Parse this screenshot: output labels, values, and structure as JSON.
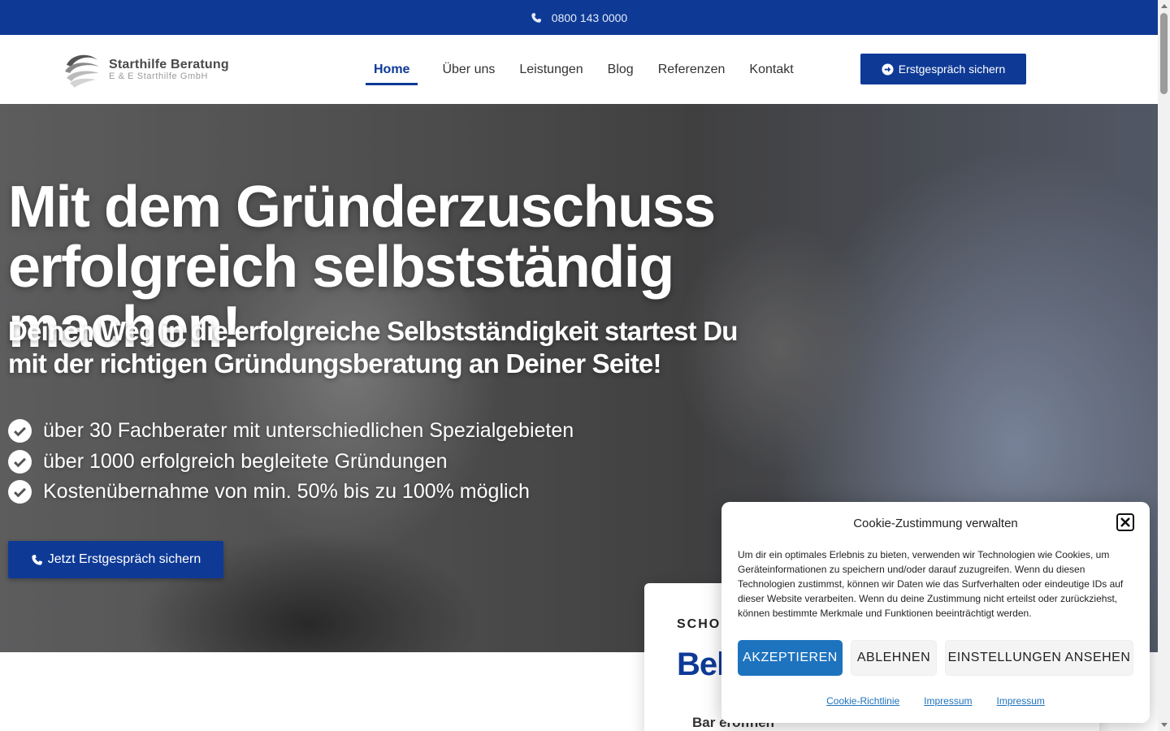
{
  "topbar": {
    "phone": "0800 143 0000",
    "icon": "phone-icon"
  },
  "brand": {
    "name": "Starthilfe Beratung",
    "company": "E & E Starthilfe GmbH"
  },
  "nav": {
    "items": [
      {
        "label": "Home",
        "active": true
      },
      {
        "label": "Über uns"
      },
      {
        "label": "Leistungen"
      },
      {
        "label": "Blog"
      },
      {
        "label": "Referenzen"
      },
      {
        "label": "Kontakt"
      }
    ],
    "cta": "Erstgespräch sichern"
  },
  "hero": {
    "headline": "Mit dem Gründerzuschuss erfolgreich selbstständig machen!",
    "subheadline": "Deinen Weg in die erfolgreiche Selbstständigkeit startest Du mit der richtigen Gründungsberatung an Deiner Seite!",
    "bullets": [
      "über 30 Fachberater mit unterschiedlichen Spezialgebieten",
      "über 1000 erfolgreich begleitete Gründungen",
      "Kostenübernahme von min. 50% bis zu 100% möglich"
    ],
    "cta": "Jetzt Erstgespräch sichern"
  },
  "card": {
    "eyebrow": "SCHON",
    "title": "Beli",
    "item": "Bar eröffnen"
  },
  "cookie": {
    "title": "Cookie-Zustimmung verwalten",
    "body": "Um dir ein optimales Erlebnis zu bieten, verwenden wir Technologien wie Cookies, um Geräteinformationen zu speichern und/oder darauf zuzugreifen. Wenn du diesen Technologien zustimmst, können wir Daten wie das Surfverhalten oder eindeutige IDs auf dieser Website verarbeiten. Wenn du deine Zustimmung nicht erteilst oder zurückziehst, können bestimmte Merkmale und Funktionen beeinträchtigt werden.",
    "accept": "AKZEPTIEREN",
    "deny": "ABLEHNEN",
    "settings": "EINSTELLUNGEN ANSEHEN",
    "links": [
      "Cookie-Richtlinie",
      "Impressum",
      "Impressum"
    ]
  },
  "colors": {
    "primary": "#0e3a96",
    "cookie_accent": "#1e73be"
  }
}
